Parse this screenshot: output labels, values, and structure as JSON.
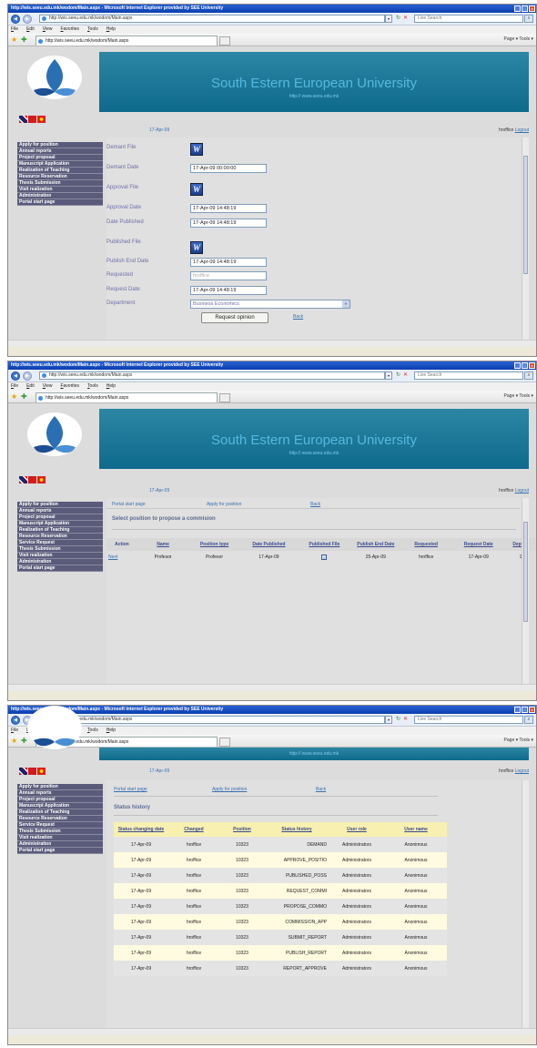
{
  "browser": {
    "title": "http://wis.seeu.edu.mk/wodom/Main.aspx - Microsoft Internet Explorer provided by SEE University",
    "address": "http://wis.seeu.edu.mk/wodom/Main.aspx",
    "search_placeholder": "Live Search",
    "menu": [
      "File",
      "Edit",
      "View",
      "Favorites",
      "Tools",
      "Help"
    ],
    "tab": "http://wis.seeu.edu.mk/wodom/Main.aspx",
    "cmd": "Page ▾  Tools ▾"
  },
  "site": {
    "title": "South Estern European University",
    "url": "http:// www.seeu.edu.mk",
    "date": "17-Apr-09",
    "user": "hroffice",
    "logout": "Logout"
  },
  "sidebar1": [
    "Apply for position",
    "Annual reports",
    "Project proposal",
    "Manuscript Application",
    "Realization of Teaching",
    "Resource Reservation",
    "Thesis Submission",
    "Visit realization",
    "Administration",
    "Portal start page"
  ],
  "sidebar2": [
    "Apply for position",
    "Annual reports",
    "Project proposal",
    "Manuscript Application",
    "Realization of Teaching",
    "Resource Reservation",
    "Service Request",
    "Thesis Submission",
    "Visit realization",
    "Administration",
    "Portal start page"
  ],
  "form": {
    "demant_file": "Demant File",
    "demant_date_label": "Demant Date",
    "demant_date": "17-Apr-09 00:00:00",
    "approval_file": "Approval File",
    "approval_date_label": "Approval Date",
    "approval_date": "17-Apr-09 14:48:19",
    "date_published_label": "Date Published",
    "date_published": "17-Apr-09 14:48:19",
    "published_file": "Published File",
    "publish_end_label": "Publish End Date",
    "publish_end": "17-Apr-09 14:48:19",
    "requested_label": "Requested",
    "requested": "hroffice",
    "request_date_label": "Request Date",
    "request_date": "17-Apr-09 14:48:19",
    "department_label": "Department",
    "department": "Business Economics",
    "request_button": "Request opinion",
    "back": "Back",
    "word_icon": "W"
  },
  "links": {
    "portal": "Portal start page",
    "apply": "Apply for position",
    "back": "Back"
  },
  "positions": {
    "title": "Select position to propose a commision",
    "headers": [
      "Action",
      "Name",
      "Position type",
      "Date Published",
      "Published File",
      "Publish End Date",
      "Requested",
      "Request Date",
      "Departi"
    ],
    "row": [
      "Next",
      "Profesor",
      "Profesor",
      "17-Apr-09",
      "",
      "25-Apr-09",
      "hroffice",
      "17-Apr-09",
      "1"
    ]
  },
  "history": {
    "title": "Status history",
    "headers": [
      "Status changing date",
      "Changed",
      "Position",
      "Status history",
      "User role",
      "User name"
    ],
    "rows": [
      [
        "17-Apr-09",
        "hroffice",
        "10323",
        "DEMAND",
        "Administrators",
        "Anonimous"
      ],
      [
        "17-Apr-09",
        "hroffice",
        "10323",
        "APPROVE_POSITIO",
        "Administrators",
        "Anonimous"
      ],
      [
        "17-Apr-09",
        "hroffice",
        "10323",
        "PUBLISHED_POSS",
        "Administrators",
        "Anonimous"
      ],
      [
        "17-Apr-09",
        "hroffice",
        "10323",
        "REQUEST_COMMI",
        "Administrators",
        "Anonimous"
      ],
      [
        "17-Apr-09",
        "hroffice",
        "10323",
        "PROPOSE_COMMO",
        "Administrators",
        "Anonimous"
      ],
      [
        "17-Apr-09",
        "hroffice",
        "10323",
        "COMMISSION_APP",
        "Administrators",
        "Anonimous"
      ],
      [
        "17-Apr-09",
        "hroffice",
        "10323",
        "SUBMIT_REPORT",
        "Administrators",
        "Anonimous"
      ],
      [
        "17-Apr-09",
        "hroffice",
        "10323",
        "PUBLISH_REPORT",
        "Administrators",
        "Anonimous"
      ],
      [
        "17-Apr-09",
        "hroffice",
        "10323",
        "REPORT_APPROVE",
        "Administrators",
        "Anonimous"
      ]
    ]
  }
}
